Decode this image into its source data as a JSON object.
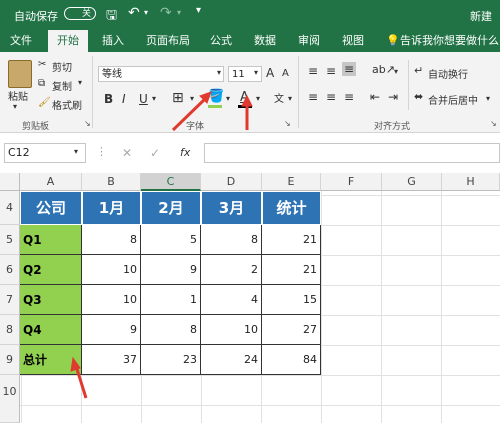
{
  "titlebar": {
    "autosave": "自动保存",
    "toggle": "关",
    "title": "新建"
  },
  "tabs": [
    "文件",
    "开始",
    "插入",
    "页面布局",
    "公式",
    "数据",
    "审阅",
    "视图"
  ],
  "tell_me": "告诉我你想要做什么",
  "clipboard": {
    "paste": "粘贴",
    "cut": "剪切",
    "copy": "复制",
    "format_painter": "格式刷",
    "group": "剪贴板"
  },
  "font": {
    "name": "等线",
    "size": "11",
    "bold": "B",
    "italic": "I",
    "underline": "U",
    "font_color": "A",
    "group": "字体"
  },
  "alignment": {
    "wrap_text": "自动换行",
    "merge": "合并后居中",
    "group": "对齐方式"
  },
  "formula_bar": {
    "name_box": "C12",
    "fx": "fx"
  },
  "columns": [
    "A",
    "B",
    "C",
    "D",
    "E",
    "F",
    "G",
    "H"
  ],
  "rows": [
    "4",
    "5",
    "6",
    "7",
    "8",
    "9",
    "10"
  ],
  "sheet": {
    "header": [
      "公司",
      "1月",
      "2月",
      "3月",
      "统计"
    ],
    "data": [
      {
        "label": "Q1",
        "values": [
          "8",
          "5",
          "8",
          "21"
        ]
      },
      {
        "label": "Q2",
        "values": [
          "10",
          "9",
          "2",
          "21"
        ]
      },
      {
        "label": "Q3",
        "values": [
          "10",
          "1",
          "4",
          "15"
        ]
      },
      {
        "label": "Q4",
        "values": [
          "9",
          "8",
          "10",
          "27"
        ]
      },
      {
        "label": "总计",
        "values": [
          "37",
          "23",
          "24",
          "84"
        ]
      }
    ]
  },
  "colors": {
    "ribbon_green": "#217346",
    "header_blue": "#2e74b5",
    "label_green": "#92d050",
    "arrow_red": "#e03a2f"
  }
}
